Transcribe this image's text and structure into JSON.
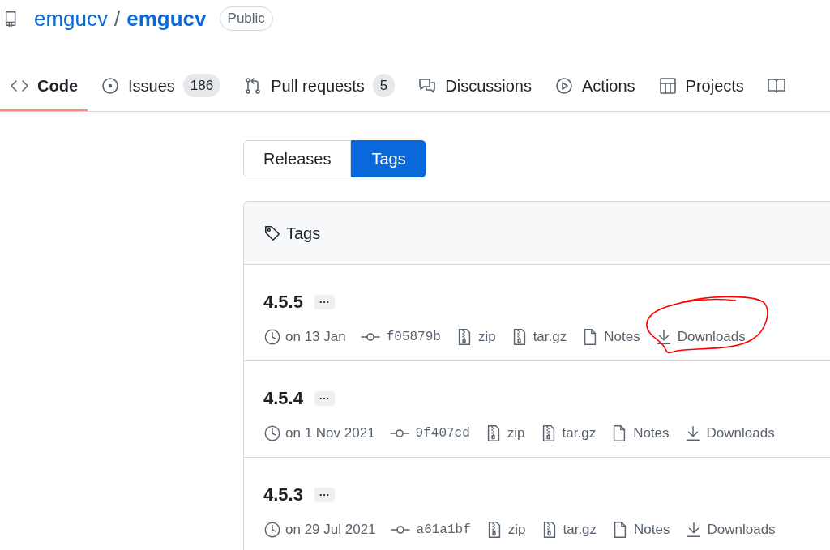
{
  "repo": {
    "owner": "emgucv",
    "separator": "/",
    "name": "emgucv",
    "visibility": "Public"
  },
  "tabs": [
    {
      "kind": "code",
      "label": "Code",
      "selected": true
    },
    {
      "kind": "issue",
      "label": "Issues",
      "count": "186",
      "selected": false
    },
    {
      "kind": "pull",
      "label": "Pull requests",
      "count": "5",
      "selected": false
    },
    {
      "kind": "discussion",
      "label": "Discussions",
      "selected": false
    },
    {
      "kind": "actions",
      "label": "Actions",
      "selected": false
    },
    {
      "kind": "projects",
      "label": "Projects",
      "selected": false
    },
    {
      "kind": "wiki",
      "selected": false
    }
  ],
  "switch": [
    {
      "label": "Releases",
      "selected": false
    },
    {
      "label": "Tags",
      "selected": true
    }
  ],
  "tags_box": {
    "title": "Tags",
    "tags": [
      {
        "name": "4.5.5",
        "more": "···",
        "date": "on 13 Jan",
        "commit": "f05879b",
        "links": [
          {
            "kind": "zip",
            "label": "zip",
            "circled": false
          },
          {
            "kind": "zip",
            "label": "tar.gz",
            "circled": false
          },
          {
            "kind": "notes",
            "label": "Notes",
            "circled": false
          },
          {
            "kind": "download",
            "label": "Downloads",
            "circled": true
          }
        ]
      },
      {
        "name": "4.5.4",
        "more": "···",
        "date": "on 1 Nov 2021",
        "commit": "9f407cd",
        "links": [
          {
            "kind": "zip",
            "label": "zip",
            "circled": false
          },
          {
            "kind": "zip",
            "label": "tar.gz",
            "circled": false
          },
          {
            "kind": "notes",
            "label": "Notes",
            "circled": false
          },
          {
            "kind": "download",
            "label": "Downloads",
            "circled": false
          }
        ]
      },
      {
        "name": "4.5.3",
        "more": "···",
        "date": "on 29 Jul 2021",
        "commit": "a61a1bf",
        "links": [
          {
            "kind": "zip",
            "label": "zip",
            "circled": false
          },
          {
            "kind": "zip",
            "label": "tar.gz",
            "circled": false
          },
          {
            "kind": "notes",
            "label": "Notes",
            "circled": false
          },
          {
            "kind": "download",
            "label": "Downloads",
            "circled": false
          }
        ]
      }
    ]
  }
}
